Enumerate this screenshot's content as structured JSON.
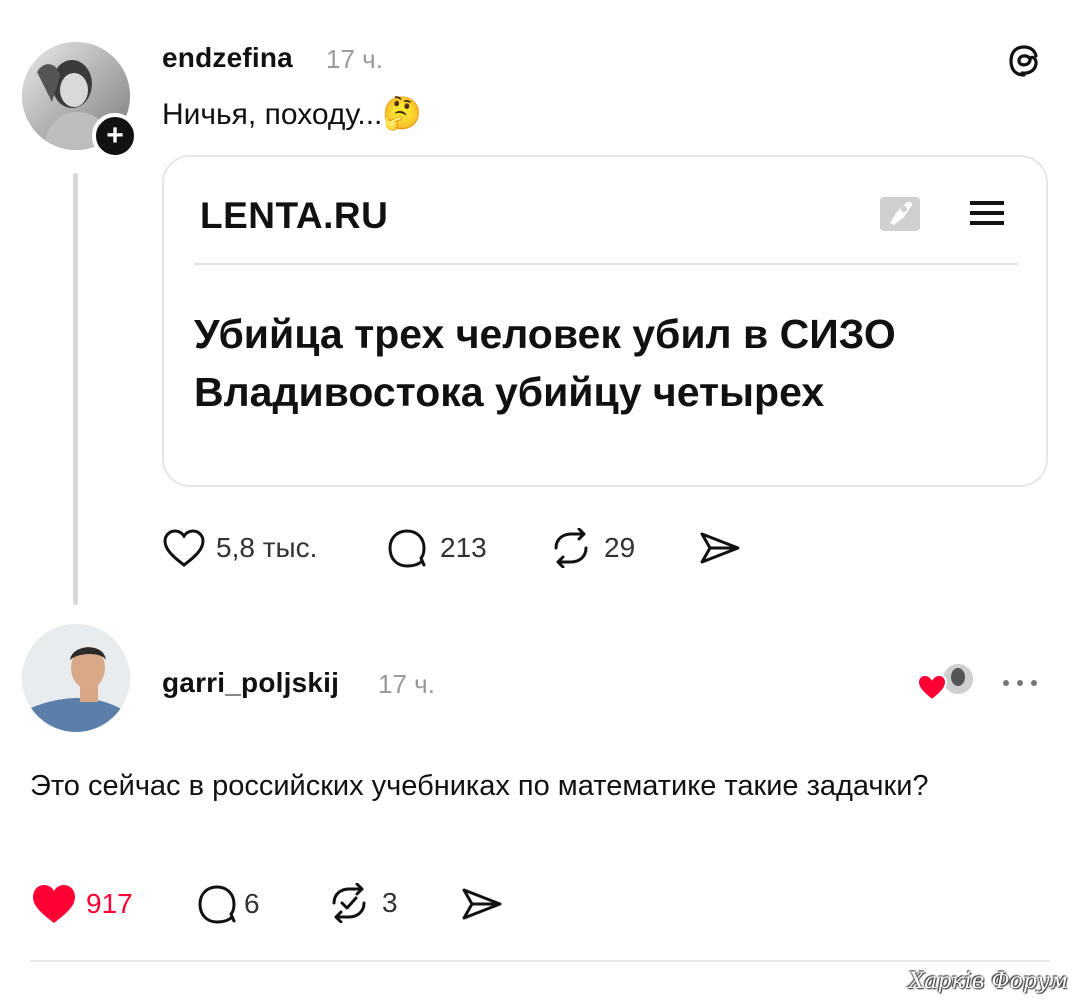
{
  "post": {
    "username": "endzefina",
    "time": "17 ч.",
    "text": "Ничья, походу...",
    "emoji": "🤔",
    "follow_icon": "plus-icon",
    "app_icon": "threads-logo-icon",
    "card": {
      "site": "LENTA.RU",
      "headline": "Убийца трех человек убил в СИЗО Владивостока убийцу четырех"
    },
    "stats": {
      "likes": "5,8 тыс.",
      "replies": "213",
      "reposts": "29"
    }
  },
  "reply": {
    "username": "garri_poljskij",
    "time": "17 ч.",
    "text": "Это сейчас в российских учебниках по математике такие задачки?",
    "stats": {
      "likes": "917",
      "replies": "6",
      "reposts": "3"
    },
    "colors": {
      "liked": "#ff0034"
    }
  },
  "watermark": "Харків Форум"
}
